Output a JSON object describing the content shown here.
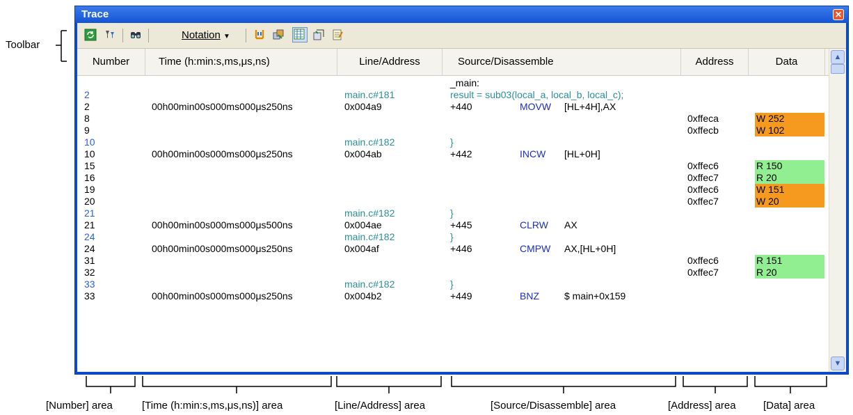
{
  "window": {
    "title": "Trace",
    "close_icon": "close-icon"
  },
  "toolbar": {
    "notation_label": "Notation",
    "icons": [
      "refresh-icon",
      "filter-icon",
      "find-icon",
      "dropdown-arrow-icon",
      "copy-icon",
      "link-icon",
      "column-icon",
      "export-icon",
      "edit-icon"
    ]
  },
  "columns": [
    "Number",
    "Time (h:min:s,ms,μs,ns)",
    "Line/Address",
    "Source/Disassemble",
    "Address",
    "Data"
  ],
  "rows": [
    {
      "num": "",
      "time": "",
      "line": "",
      "src": "_main:",
      "mnem": "",
      "op": "",
      "addr": "",
      "data": "",
      "kind": "label"
    },
    {
      "num": "2",
      "time": "",
      "line": "main.c#181",
      "src": "result = sub03(local_a, local_b, local_c);",
      "mnem": "",
      "op": "",
      "addr": "",
      "data": "",
      "kind": "source"
    },
    {
      "num": "2",
      "time": "00h00min00s000ms000μs250ns",
      "line": "0x004a9",
      "src": "+440",
      "mnem": "MOVW",
      "op": "[HL+4H],AX",
      "addr": "",
      "data": "",
      "kind": "inst"
    },
    {
      "num": "8",
      "time": "",
      "line": "",
      "src": "",
      "mnem": "",
      "op": "",
      "addr": "0xffeca",
      "data": "W 252",
      "kind": "write"
    },
    {
      "num": "9",
      "time": "",
      "line": "",
      "src": "",
      "mnem": "",
      "op": "",
      "addr": "0xffecb",
      "data": "W 102",
      "kind": "write"
    },
    {
      "num": "10",
      "time": "",
      "line": "main.c#182",
      "src": "}",
      "mnem": "",
      "op": "",
      "addr": "",
      "data": "",
      "kind": "source"
    },
    {
      "num": "10",
      "time": "00h00min00s000ms000μs250ns",
      "line": "0x004ab",
      "src": "+442",
      "mnem": "INCW",
      "op": "[HL+0H]",
      "addr": "",
      "data": "",
      "kind": "inst"
    },
    {
      "num": "15",
      "time": "",
      "line": "",
      "src": "",
      "mnem": "",
      "op": "",
      "addr": "0xffec6",
      "data": "R 150",
      "kind": "read"
    },
    {
      "num": "16",
      "time": "",
      "line": "",
      "src": "",
      "mnem": "",
      "op": "",
      "addr": "0xffec7",
      "data": "R 20",
      "kind": "read"
    },
    {
      "num": "19",
      "time": "",
      "line": "",
      "src": "",
      "mnem": "",
      "op": "",
      "addr": "0xffec6",
      "data": "W 151",
      "kind": "write"
    },
    {
      "num": "20",
      "time": "",
      "line": "",
      "src": "",
      "mnem": "",
      "op": "",
      "addr": "0xffec7",
      "data": "W 20",
      "kind": "write"
    },
    {
      "num": "21",
      "time": "",
      "line": "main.c#182",
      "src": "}",
      "mnem": "",
      "op": "",
      "addr": "",
      "data": "",
      "kind": "source"
    },
    {
      "num": "21",
      "time": "00h00min00s000ms000μs500ns",
      "line": "0x004ae",
      "src": "+445",
      "mnem": "CLRW",
      "op": "AX",
      "addr": "",
      "data": "",
      "kind": "inst"
    },
    {
      "num": "24",
      "time": "",
      "line": "main.c#182",
      "src": "}",
      "mnem": "",
      "op": "",
      "addr": "",
      "data": "",
      "kind": "source"
    },
    {
      "num": "24",
      "time": "00h00min00s000ms000μs250ns",
      "line": "0x004af",
      "src": "+446",
      "mnem": "CMPW",
      "op": "AX,[HL+0H]",
      "addr": "",
      "data": "",
      "kind": "inst"
    },
    {
      "num": "31",
      "time": "",
      "line": "",
      "src": "",
      "mnem": "",
      "op": "",
      "addr": "0xffec6",
      "data": "R 151",
      "kind": "read"
    },
    {
      "num": "32",
      "time": "",
      "line": "",
      "src": "",
      "mnem": "",
      "op": "",
      "addr": "0xffec7",
      "data": "R 20",
      "kind": "read"
    },
    {
      "num": "33",
      "time": "",
      "line": "main.c#182",
      "src": "}",
      "mnem": "",
      "op": "",
      "addr": "",
      "data": "",
      "kind": "source"
    },
    {
      "num": "33",
      "time": "00h00min00s000ms000μs250ns",
      "line": "0x004b2",
      "src": "+449",
      "mnem": "BNZ",
      "op": "$ main+0x159",
      "addr": "",
      "data": "",
      "kind": "inst"
    }
  ],
  "annotations": {
    "toolbar": "Toolbar",
    "areas": [
      "[Number] area",
      "[Time (h:min:s,ms,μs,ns)] area",
      "[Line/Address] area",
      "[Source/Disassemble] area",
      "[Address] area",
      "[Data] area"
    ]
  },
  "colors": {
    "title_bar": "#1454d6",
    "write_bg": "#f59a1f",
    "read_bg": "#91ee91",
    "source_text": "#2a8f9a"
  }
}
